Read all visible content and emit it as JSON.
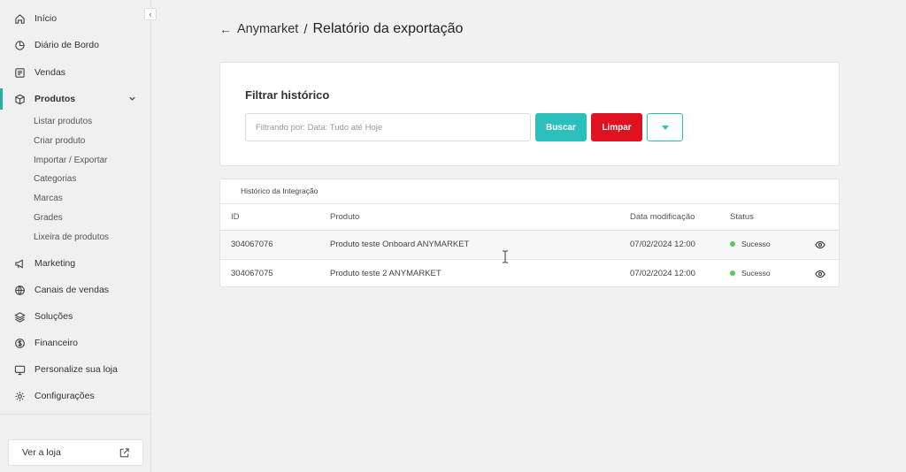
{
  "sidebar": {
    "items": [
      {
        "label": "Início",
        "icon": "home-icon"
      },
      {
        "label": "Diário de Bordo",
        "icon": "chart-pie-icon"
      },
      {
        "label": "Vendas",
        "icon": "receipt-icon"
      },
      {
        "label": "Produtos",
        "icon": "box-icon"
      },
      {
        "label": "Marketing",
        "icon": "megaphone-icon"
      },
      {
        "label": "Canais de vendas",
        "icon": "globe-icon"
      },
      {
        "label": "Soluções",
        "icon": "layers-icon"
      },
      {
        "label": "Financeiro",
        "icon": "dollar-icon"
      },
      {
        "label": "Personalize sua loja",
        "icon": "monitor-icon"
      },
      {
        "label": "Configurações",
        "icon": "gear-icon"
      }
    ],
    "submenu": [
      "Listar produtos",
      "Criar produto",
      "Importar / Exportar",
      "Categorias",
      "Marcas",
      "Grades",
      "Lixeira de produtos"
    ],
    "store_button": "Ver a loja",
    "accent_color": "#2aaea8"
  },
  "header": {
    "breadcrumb": "Anymarket",
    "separator": "/",
    "title": "Relatório da exportação"
  },
  "filter": {
    "title": "Filtrar histórico",
    "placeholder": "Filtrando por: Data: Tudo até Hoje",
    "search_label": "Buscar",
    "clear_label": "Limpar",
    "search_color": "#2bbfbd",
    "clear_color": "#e1121f"
  },
  "history": {
    "title": "Histórico da Integração",
    "columns": [
      "ID",
      "Produto",
      "Data modificação",
      "Status"
    ],
    "rows": [
      {
        "id": "304067076",
        "product": "Produto teste Onboard ANYMARKET",
        "date": "07/02/2024 12:00",
        "status": "Sucesso"
      },
      {
        "id": "304067075",
        "product": "Produto teste 2 ANYMARKET",
        "date": "07/02/2024 12:00",
        "status": "Sucesso"
      }
    ]
  }
}
